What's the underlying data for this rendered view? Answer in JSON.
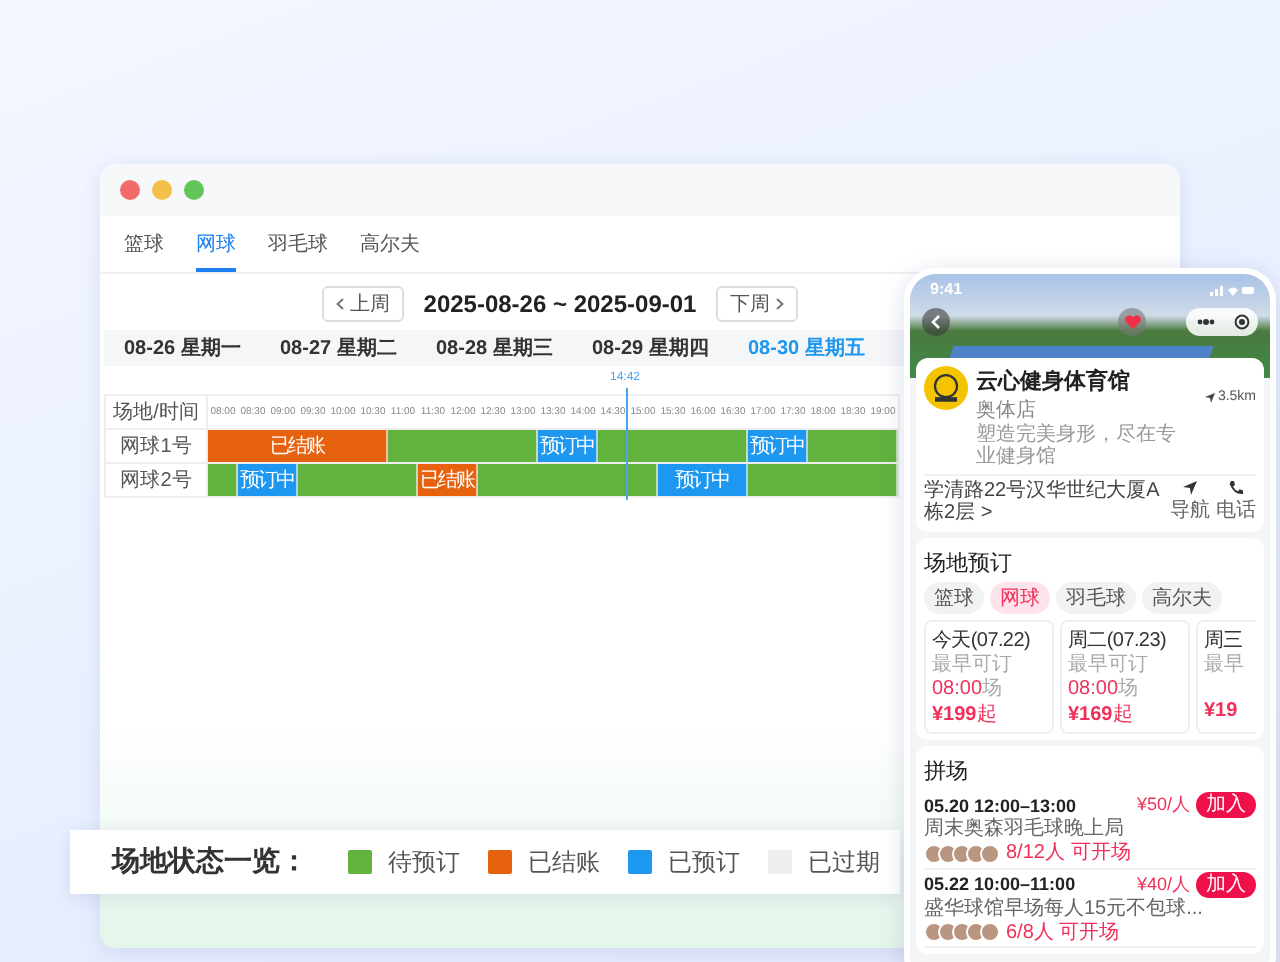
{
  "window": {
    "tabs": [
      {
        "label": "篮球",
        "selected": false
      },
      {
        "label": "网球",
        "selected": true
      },
      {
        "label": "羽毛球",
        "selected": false
      },
      {
        "label": "高尔夫",
        "selected": false
      }
    ],
    "week_nav": {
      "prev": "上周",
      "range": "2025-08-26 ~ 2025-09-01",
      "next": "下周"
    },
    "days": [
      {
        "label": "08-26 星期一",
        "selected": false
      },
      {
        "label": "08-27 星期二",
        "selected": false
      },
      {
        "label": "08-28 星期三",
        "selected": false
      },
      {
        "label": "08-29 星期四",
        "selected": false
      },
      {
        "label": "08-30 星期五",
        "selected": true
      }
    ],
    "grid": {
      "corner": "场地/时间",
      "times": [
        {
          "label": "08:00"
        },
        {
          "label": "08:30"
        },
        {
          "label": "09:00"
        },
        {
          "label": "09:30"
        },
        {
          "label": "10:00"
        },
        {
          "label": "10:30"
        },
        {
          "label": "11:00"
        },
        {
          "label": "11:30"
        },
        {
          "label": "12:00"
        },
        {
          "label": "12:30"
        },
        {
          "label": "13:00"
        },
        {
          "label": "13:30"
        },
        {
          "label": "14:00"
        },
        {
          "label": "14:30",
          "now": "14:42"
        },
        {
          "label": "15:00"
        },
        {
          "label": "15:30"
        },
        {
          "label": "16:00"
        },
        {
          "label": "16:30"
        },
        {
          "label": "17:00"
        },
        {
          "label": "17:30"
        },
        {
          "label": "18:00"
        },
        {
          "label": "18:30"
        },
        {
          "label": "19:00"
        }
      ],
      "rows": [
        {
          "name": "网球1号",
          "cells": [
            {
              "kind": "checked_out",
              "label": "已结账"
            },
            {
              "kind": "checked_out"
            },
            {
              "kind": "checked_out"
            },
            {
              "kind": "checked_out"
            },
            {
              "kind": "checked_out"
            },
            {
              "kind": "checked_out"
            },
            {
              "kind": "available"
            },
            {
              "kind": "available"
            },
            {
              "kind": "available"
            },
            {
              "kind": "available"
            },
            {
              "kind": "available"
            },
            {
              "kind": "booked",
              "label": "预订中"
            },
            {
              "kind": "booked"
            },
            {
              "kind": "available"
            },
            {
              "kind": "available"
            },
            {
              "kind": "available"
            },
            {
              "kind": "available"
            },
            {
              "kind": "available"
            },
            {
              "kind": "booked",
              "label": "预订中"
            },
            {
              "kind": "booked"
            },
            {
              "kind": "available"
            },
            {
              "kind": "available"
            },
            {
              "kind": "available"
            }
          ]
        },
        {
          "name": "网球2号",
          "cells": [
            {
              "kind": "available"
            },
            {
              "kind": "booked",
              "label": "预订中"
            },
            {
              "kind": "booked"
            },
            {
              "kind": "available"
            },
            {
              "kind": "available"
            },
            {
              "kind": "available"
            },
            {
              "kind": "available"
            },
            {
              "kind": "checked_out",
              "label": "已结账"
            },
            {
              "kind": "checked_out"
            },
            {
              "kind": "available"
            },
            {
              "kind": "available"
            },
            {
              "kind": "available"
            },
            {
              "kind": "available"
            },
            {
              "kind": "available"
            },
            {
              "kind": "available"
            },
            {
              "kind": "booked",
              "label": "预订中"
            },
            {
              "kind": "booked"
            },
            {
              "kind": "booked"
            },
            {
              "kind": "available"
            },
            {
              "kind": "available"
            },
            {
              "kind": "available"
            },
            {
              "kind": "available"
            },
            {
              "kind": "available"
            }
          ]
        }
      ]
    }
  },
  "legend": {
    "title": "场地状态一览：",
    "items": [
      {
        "kind": "available",
        "label": "待预订"
      },
      {
        "kind": "checked_out",
        "label": "已结账"
      },
      {
        "kind": "booked",
        "label": "已预订"
      },
      {
        "kind": "expired",
        "label": "已过期"
      }
    ]
  },
  "phone": {
    "time": "9:41",
    "favorite": true,
    "venue": {
      "name": "云心健身体育馆",
      "branch": "奥体店",
      "description": "塑造完美身形，尽在专业健身馆",
      "distance": "3.5km",
      "address": "学清路22号汉华世纪大厦A栋2层 >",
      "actions": [
        "导航",
        "电话"
      ]
    },
    "booking": {
      "title": "场地预订",
      "chips": [
        {
          "label": "篮球",
          "selected": false
        },
        {
          "label": "网球",
          "selected": true
        },
        {
          "label": "羽毛球",
          "selected": false
        },
        {
          "label": "高尔夫",
          "selected": false
        }
      ],
      "days": [
        {
          "day": "今天(07.22)",
          "earliest_prefix": "最早可订",
          "earliest_time": "08:00",
          "earliest_suffix": "场",
          "price": "¥199",
          "price_unit": "起"
        },
        {
          "day": "周二(07.23)",
          "earliest_prefix": "最早可订",
          "earliest_time": "08:00",
          "earliest_suffix": "场",
          "price": "¥169",
          "price_unit": "起"
        },
        {
          "day": "周三",
          "earliest_prefix": "最早",
          "price": "¥19"
        }
      ]
    },
    "group": {
      "title": "拼场",
      "items": [
        {
          "time": "05.20 12:00–13:00",
          "description": "周末奥森羽毛球晚上局",
          "count": "8/12人",
          "status": "可开场",
          "price": "¥50/人",
          "button": "加入"
        },
        {
          "time": "05.22 10:00–11:00",
          "description": "盛华球馆早场每人15元不包球...",
          "count": "6/8人",
          "status": "可开场",
          "price": "¥40/人",
          "button": "加入"
        }
      ]
    }
  }
}
